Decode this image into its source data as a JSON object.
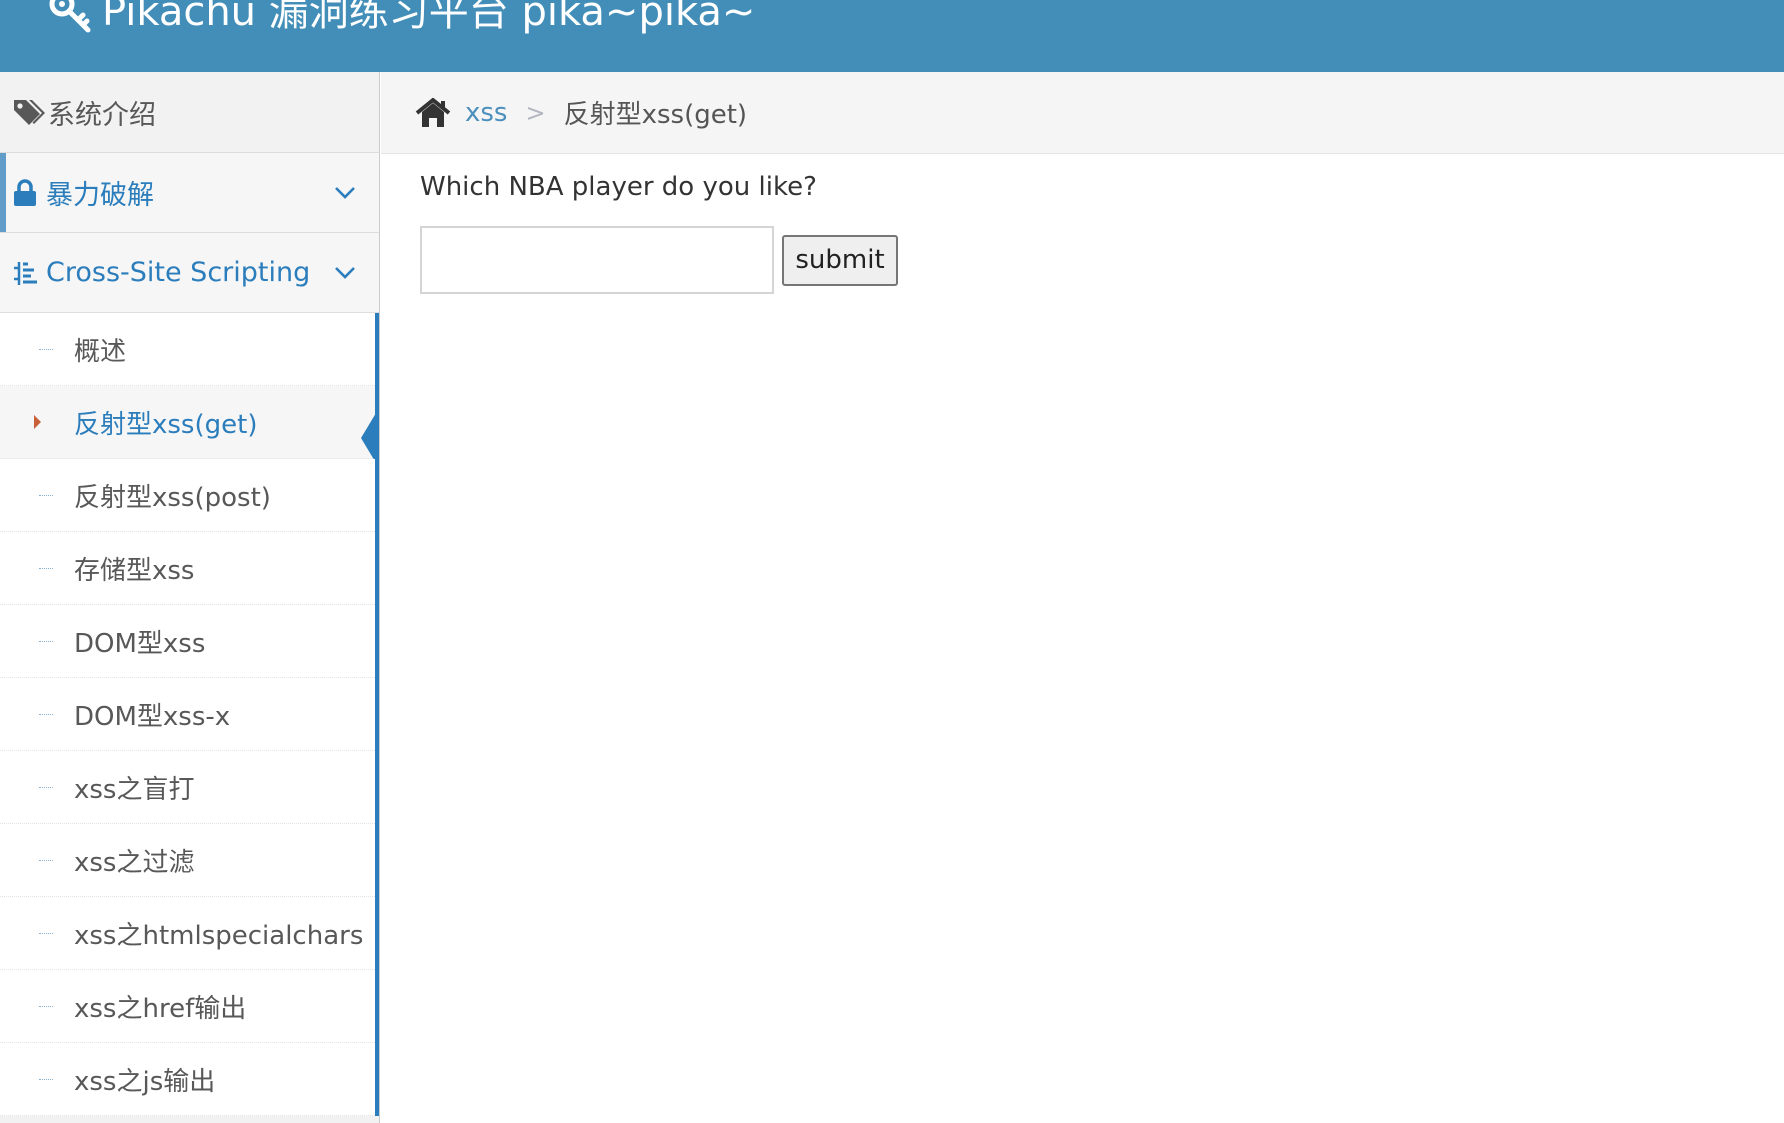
{
  "header": {
    "title": "Pikachu 漏洞练习平台 pika~pika~",
    "icon": "key-icon",
    "background_color": "#438eb9"
  },
  "sidebar": {
    "intro_label": "系统介绍",
    "sections": [
      {
        "label": "暴力破解",
        "icon": "lock-icon",
        "expanded": false
      },
      {
        "label": "Cross-Site Scripting",
        "icon": "list-icon",
        "expanded": true
      }
    ],
    "xss_items": [
      {
        "label": "概述"
      },
      {
        "label": "反射型xss(get)",
        "active": true
      },
      {
        "label": "反射型xss(post)"
      },
      {
        "label": "存储型xss"
      },
      {
        "label": "DOM型xss"
      },
      {
        "label": "DOM型xss-x"
      },
      {
        "label": "xss之盲打"
      },
      {
        "label": "xss之过滤"
      },
      {
        "label": "xss之htmlspecialchars"
      },
      {
        "label": "xss之href输出"
      },
      {
        "label": "xss之js输出"
      }
    ]
  },
  "breadcrumb": {
    "link": "xss",
    "separator": ">",
    "current": "反射型xss(get)"
  },
  "main": {
    "question": "Which NBA player do you like?",
    "input_value": "",
    "submit_label": "submit"
  },
  "colors": {
    "accent": "#2b7dbc",
    "active_caret": "#c86139"
  }
}
